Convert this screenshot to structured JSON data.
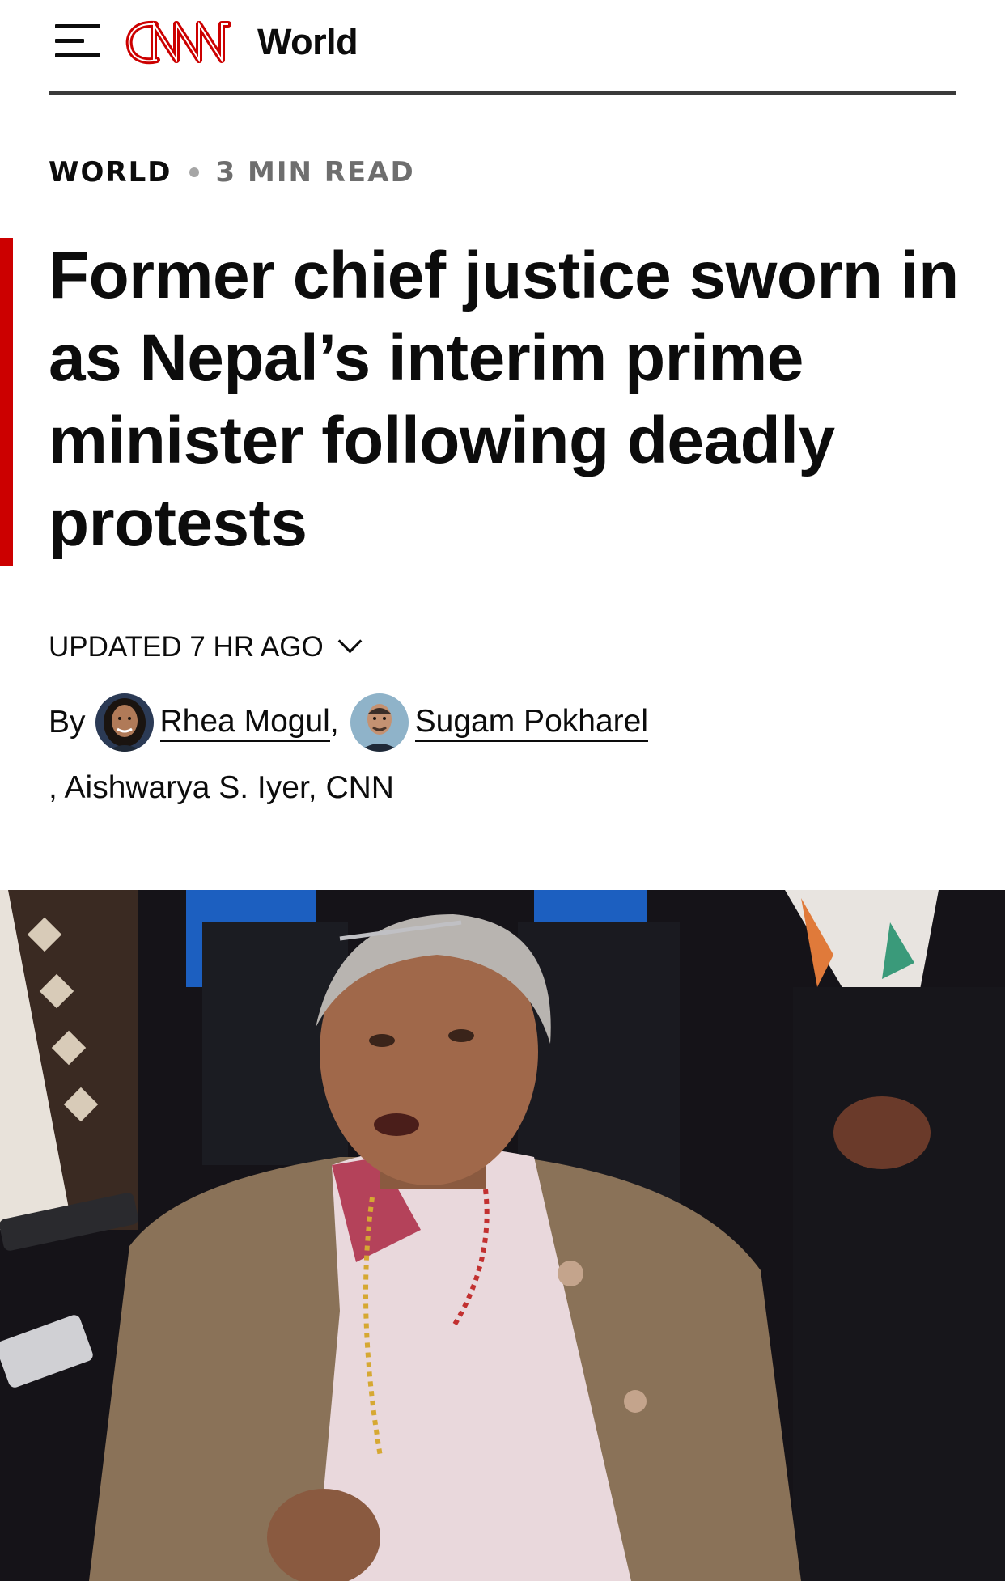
{
  "header": {
    "menu_icon": "hamburger-menu-icon",
    "logo_text": "CNN",
    "section": "World",
    "brand_color": "#cc0000"
  },
  "kicker": {
    "section": "WORLD",
    "read_time": "3 MIN READ"
  },
  "headline": "Former chief justice sworn in as Nepal’s interim prime minister following deadly protests",
  "timestamp": {
    "label": "UPDATED 7 HR AGO",
    "toggle_icon": "chevron-down-icon"
  },
  "byline": {
    "prefix": "By",
    "authors": [
      {
        "name": "Rhea Mogul",
        "avatar_icon": "author-avatar"
      },
      {
        "name": "Sugam Pokharel",
        "avatar_icon": "author-avatar"
      }
    ],
    "separator": ",",
    "rest": ", Aishwarya S. Iyer, CNN"
  }
}
